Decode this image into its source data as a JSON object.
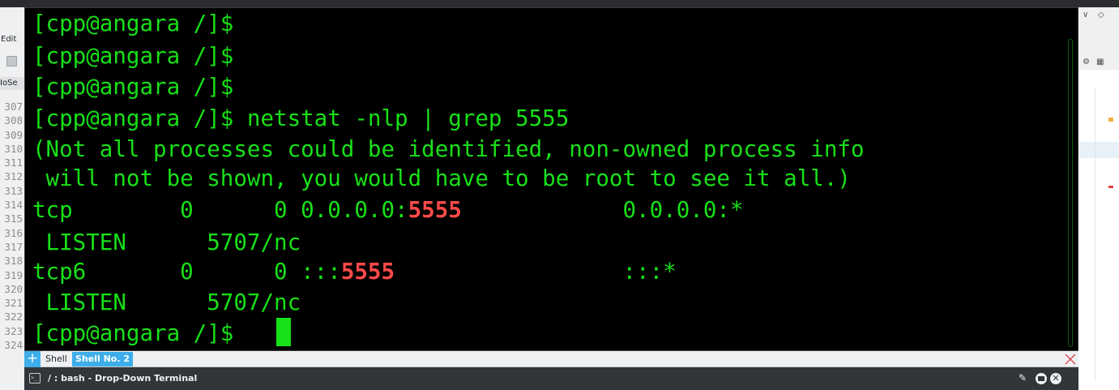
{
  "ide": {
    "menu_edit": "Edit",
    "file_tab": "IoSe",
    "line_numbers": [
      "307",
      "308",
      "309",
      "310",
      "311",
      "312",
      "313",
      "314",
      "315",
      "316",
      "317",
      "318",
      "319",
      "320",
      "321",
      "322",
      "323",
      "324"
    ]
  },
  "terminal": {
    "prompt": "[cpp@angara /]$",
    "cmd_line": "[cpp@angara /]$ netstat -nlp | grep 5555",
    "warn1": "(Not all processes could be identified, non-owned process info",
    "warn2": " will not be shown, you would have to be root to see it all.)",
    "row1": {
      "a": "tcp        0      0 0.0.0.0:",
      "port": "5555",
      "b": "            0.0.0.0:*"
    },
    "row1_state": " LISTEN      5707/nc",
    "row2": {
      "a": "tcp6       0      0 :::",
      "port": "5555",
      "b": "                 :::*"
    },
    "row2_state": " LISTEN      5707/nc",
    "last_prompt": "[cpp@angara /]$ "
  },
  "tabs": {
    "tab1": "Shell",
    "tab2": "Shell No. 2"
  },
  "status": {
    "title": "/ : bash - Drop-Down Terminal",
    "term_icon_glyph": ">_"
  },
  "colors": {
    "terminal_bg": "#000000",
    "terminal_fg": "#18e018",
    "highlight": "#ff4a4a",
    "accent": "#3daee9"
  }
}
